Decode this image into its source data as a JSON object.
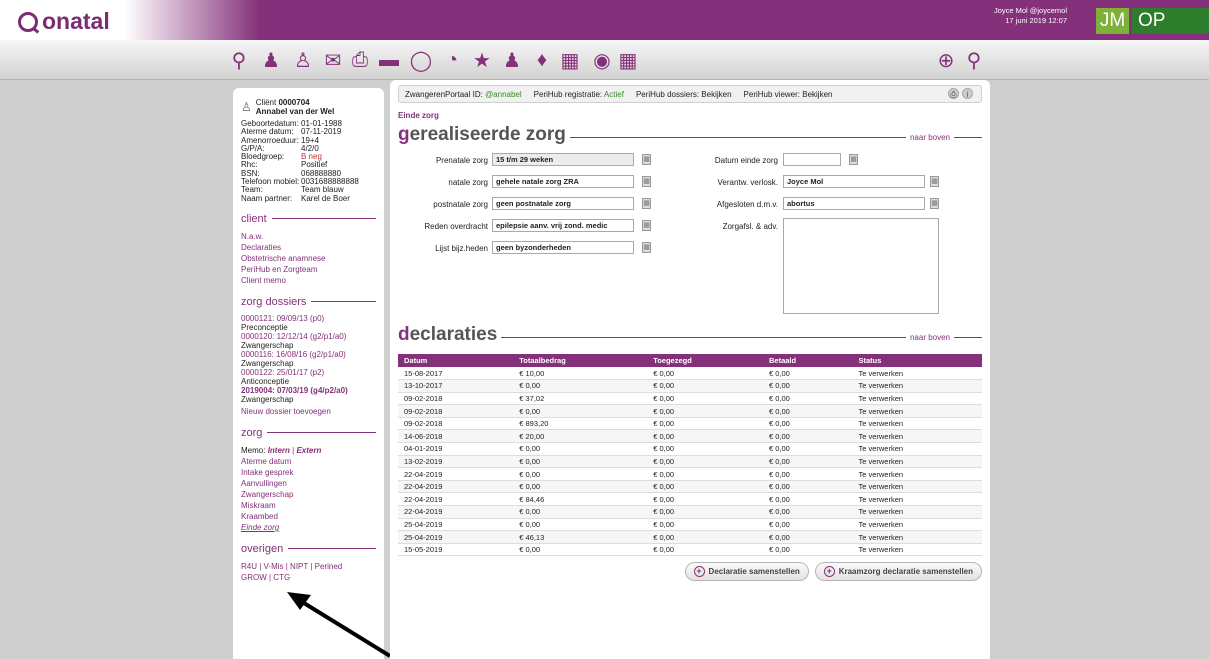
{
  "app": {
    "logo": "onatal",
    "user_line1": "Joyce Mol @joycemol",
    "user_line2": "17 juni 2019 12:07",
    "badge1": "JM",
    "badge2": "OP",
    "accent": "#84307a"
  },
  "toolbar_icons": [
    "search-icon",
    "people-icon",
    "person-icon",
    "mail-icon",
    "print-icon",
    "card-icon",
    "chat-icon",
    "pie-chart-icon",
    "star-icon",
    "family-icon",
    "chat-bubbles-icon",
    "calendar-icon",
    "globe-icon",
    "calculator-icon",
    "add-icon",
    "zoom-icon"
  ],
  "patient": {
    "client_label": "Cliënt",
    "client_id": "0000704",
    "name": "Annabel van der Wel",
    "info": [
      [
        "Geboortedatum:",
        "01-01-1988"
      ],
      [
        "Aterme datum:",
        "07-11-2019"
      ],
      [
        "Amenorroeduur:",
        "19+4"
      ],
      [
        "G/P/A:",
        "4/2/0"
      ],
      [
        "Bloedgroep:",
        "B neg"
      ],
      [
        "Rhc:",
        "Positief"
      ],
      [
        "BSN:",
        "068888880"
      ],
      [
        "Telefoon mobiel:",
        "0031688888888"
      ],
      [
        "Team:",
        "Team blauw"
      ],
      [
        "Naam partner:",
        "Karel de Boer"
      ]
    ]
  },
  "sidebar": {
    "client_title": "client",
    "client_links": [
      "N.a.w.",
      "Declaraties",
      "Obstetrische anamnese",
      "PeriHub en Zorgteam",
      "Client memo"
    ],
    "dossiers_title": "zorg dossiers",
    "dossiers": [
      [
        "0000121: 09/09/13 (p0)",
        "Preconceptie"
      ],
      [
        "0000120: 12/12/14 (g2/p1/a0)",
        "Zwangerschap"
      ],
      [
        "0000116: 16/08/16 (g2/p1/a0)",
        "Zwangerschap"
      ],
      [
        "0000122: 25/01/17 (p2)",
        "Anticonceptie"
      ],
      [
        "2019004: 07/03/19 (g4/p2/a0)",
        "Zwangerschap"
      ]
    ],
    "new_dossier": "Nieuw dossier toevoegen",
    "zorg_title": "zorg",
    "memo_label": "Memo:",
    "memo_intern": "Intern",
    "memo_sep": "|",
    "memo_extern": "Extern",
    "zorg_links": [
      "Aterme datum",
      "Intake gesprek",
      "Aanvullingen",
      "Zwangerschap",
      "Miskraam",
      "Kraambed"
    ],
    "zorg_active": "Einde zorg",
    "overigen_title": "overigen",
    "overigen_links": [
      "R4U | V-Mis | NIPT | Perined",
      "GROW | CTG"
    ]
  },
  "portal": {
    "zp_label": "ZwangerenPortaal ID:",
    "zp_val": "@annabel",
    "reg_label": "PeriHub registratie:",
    "reg_val": "Actief",
    "dossiers": "PeriHub dossiers: Bekijken",
    "viewer": "PeriHub viewer: Bekijken"
  },
  "crumb": "Einde zorg",
  "section1": {
    "first": "g",
    "rest": "erealiseerde zorg",
    "top": "naar boven"
  },
  "form": {
    "prenatale_label": "Prenatale zorg",
    "prenatale_val": "15 t/m 29 weken",
    "natale_label": "natale zorg",
    "natale_val": "gehele natale zorg ZRA",
    "postnatale_label": "postnatale zorg",
    "postnatale_val": "geen postnatale zorg",
    "reden_label": "Reden overdracht",
    "reden_val": "epilepsie aanv. vrij zond. medic",
    "lijst_label": "Lijst bijz.heden",
    "lijst_val": "geen byzonderheden",
    "einde_label": "Datum einde zorg",
    "einde_val": "",
    "verantw_label": "Verantw. verlosk.",
    "verantw_val": "Joyce Mol",
    "afgesloten_label": "Afgesloten d.m.v.",
    "afgesloten_val": "abortus",
    "zorgafsl_label": "Zorgafsl. & adv."
  },
  "section2": {
    "first": "d",
    "rest": "eclaraties",
    "top": "naar boven"
  },
  "table": {
    "headers": [
      "Datum",
      "Totaalbedrag",
      "Toegezegd",
      "Betaald",
      "Status"
    ],
    "rows": [
      [
        "15-08-2017",
        "€ 10,00",
        "€ 0,00",
        "€ 0,00",
        "Te verwerken"
      ],
      [
        "13-10-2017",
        "€ 0,00",
        "€ 0,00",
        "€ 0,00",
        "Te verwerken"
      ],
      [
        "09-02-2018",
        "€ 37,02",
        "€ 0,00",
        "€ 0,00",
        "Te verwerken"
      ],
      [
        "09-02-2018",
        "€ 0,00",
        "€ 0,00",
        "€ 0,00",
        "Te verwerken"
      ],
      [
        "09-02-2018",
        "€ 893,20",
        "€ 0,00",
        "€ 0,00",
        "Te verwerken"
      ],
      [
        "14-06-2018",
        "€ 20,00",
        "€ 0,00",
        "€ 0,00",
        "Te verwerken"
      ],
      [
        "04-01-2019",
        "€ 0,00",
        "€ 0,00",
        "€ 0,00",
        "Te verwerken"
      ],
      [
        "13-02-2019",
        "€ 0,00",
        "€ 0,00",
        "€ 0,00",
        "Te verwerken"
      ],
      [
        "22-04-2019",
        "€ 0,00",
        "€ 0,00",
        "€ 0,00",
        "Te verwerken"
      ],
      [
        "22-04-2019",
        "€ 0,00",
        "€ 0,00",
        "€ 0,00",
        "Te verwerken"
      ],
      [
        "22-04-2019",
        "€ 84,46",
        "€ 0,00",
        "€ 0,00",
        "Te verwerken"
      ],
      [
        "22-04-2019",
        "€ 0,00",
        "€ 0,00",
        "€ 0,00",
        "Te verwerken"
      ],
      [
        "25-04-2019",
        "€ 0,00",
        "€ 0,00",
        "€ 0,00",
        "Te verwerken"
      ],
      [
        "25-04-2019",
        "€ 46,13",
        "€ 0,00",
        "€ 0,00",
        "Te verwerken"
      ],
      [
        "15-05-2019",
        "€ 0,00",
        "€ 0,00",
        "€ 0,00",
        "Te verwerken"
      ]
    ]
  },
  "buttons": {
    "decl": "Declaratie samenstellen",
    "kraam": "Kraamzorg declaratie samenstellen"
  }
}
